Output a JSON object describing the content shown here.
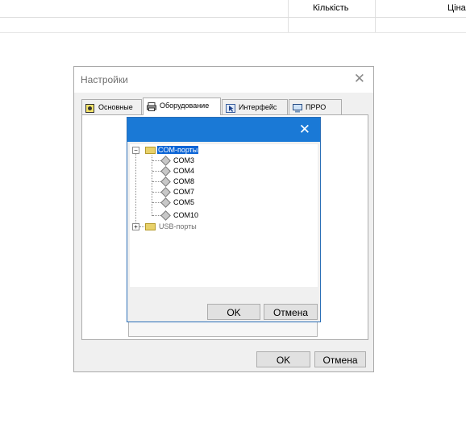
{
  "background_table": {
    "columns": [
      "Кількість",
      "Ціна"
    ]
  },
  "settings_window": {
    "title": "Настройки",
    "tabs": [
      {
        "label": "Основные",
        "icon": "settings-app-icon"
      },
      {
        "label": "Оборудование",
        "icon": "printer-icon",
        "active": true
      },
      {
        "label": "Интерфейс",
        "icon": "cursor-window-icon"
      },
      {
        "label": "ПРРО",
        "icon": "monitor-icon"
      }
    ],
    "ok_label": "OK",
    "cancel_label": "Отмена"
  },
  "com_dialog": {
    "tree": {
      "com_group": "COM-порты",
      "com_ports": [
        "COM3",
        "COM4",
        "COM8",
        "COM7",
        "COM5",
        "COM10"
      ],
      "usb_group": "USB-порты"
    },
    "ok_label": "OK",
    "cancel_label": "Отмена"
  },
  "colors": {
    "dialog_title_bar": "#1a79d6",
    "selection": "#0a64d6",
    "window_bg": "#f0f0f0"
  }
}
